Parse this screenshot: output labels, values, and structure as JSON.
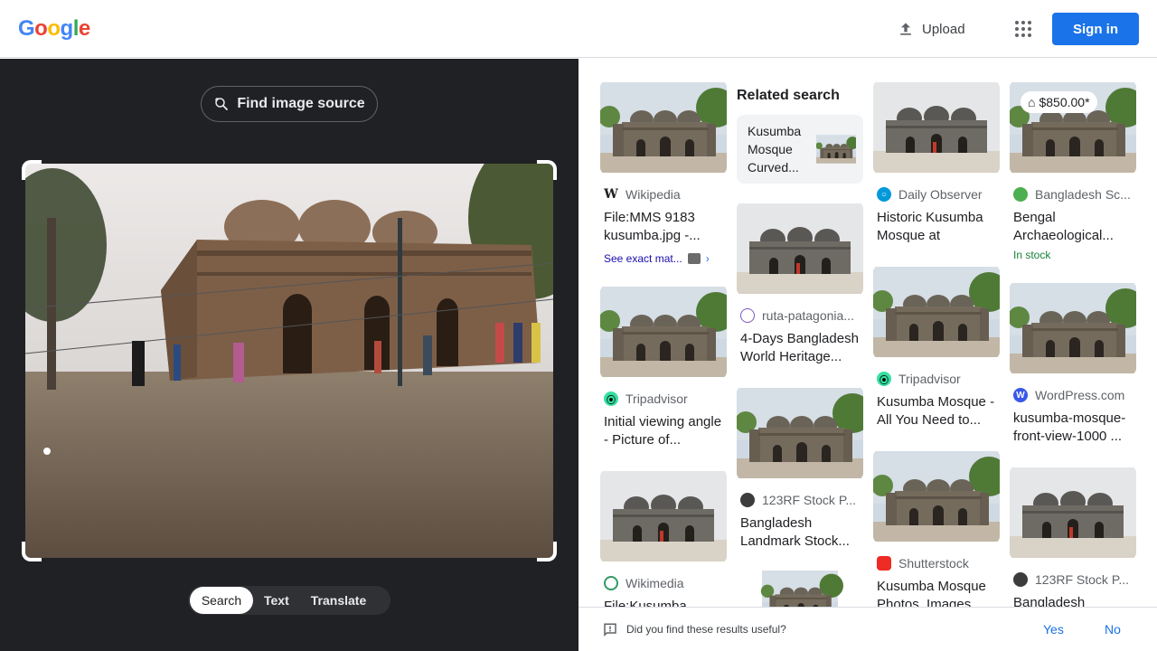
{
  "header": {
    "logo": [
      "G",
      "o",
      "o",
      "g",
      "l",
      "e"
    ],
    "logo_colors": [
      "#4285f4",
      "#ea4335",
      "#fbbc05",
      "#4285f4",
      "#34a853",
      "#ea4335"
    ],
    "upload_label": "Upload",
    "apps_icon": "apps-grid-icon",
    "signin_label": "Sign in"
  },
  "left": {
    "find_source_label": "Find image source",
    "tabs": [
      {
        "label": "Search",
        "active": true
      },
      {
        "label": "Text",
        "active": false
      },
      {
        "label": "Translate",
        "active": false
      }
    ]
  },
  "results": {
    "col1": [
      {
        "source": "Wikipedia",
        "title": "File:MMS 9183 kusumba.jpg -...",
        "see_exact": "See exact mat..."
      },
      {
        "source": "Tripadvisor",
        "title": "Initial viewing angle - Picture of..."
      },
      {
        "source": "Wikimedia",
        "title": "File:Kusumba..."
      }
    ],
    "col2": {
      "related_heading": "Related search",
      "related_card": "Kusumba Mosque Curved...",
      "items": [
        {
          "source": "ruta-patagonia...",
          "title": "4-Days Bangladesh World Heritage..."
        },
        {
          "source": "123RF Stock P...",
          "title": "Bangladesh Landmark Stock..."
        }
      ]
    },
    "col3": [
      {
        "source": "Daily Observer",
        "title": "Historic Kusumba Mosque at Manda..."
      },
      {
        "source": "Tripadvisor",
        "title": "Kusumba Mosque - All You Need to..."
      },
      {
        "source": "Shutterstock",
        "title": "Kusumba Mosque Photos, Images..."
      }
    ],
    "col4": [
      {
        "price": "$850.00*",
        "source": "Bangladesh Sc...",
        "title": "Bengal Archaeological...",
        "stock": "In stock"
      },
      {
        "source": "WordPress.com",
        "title": "kusumba-mosque-front-view-1000 ..."
      },
      {
        "source": "123RF Stock P...",
        "title": "Bangladesh"
      }
    ]
  },
  "feedback": {
    "question": "Did you find these results useful?",
    "yes": "Yes",
    "no": "No"
  },
  "colors": {
    "accent": "#1a73e8",
    "dark_panel": "#202124",
    "in_stock": "#188038"
  }
}
